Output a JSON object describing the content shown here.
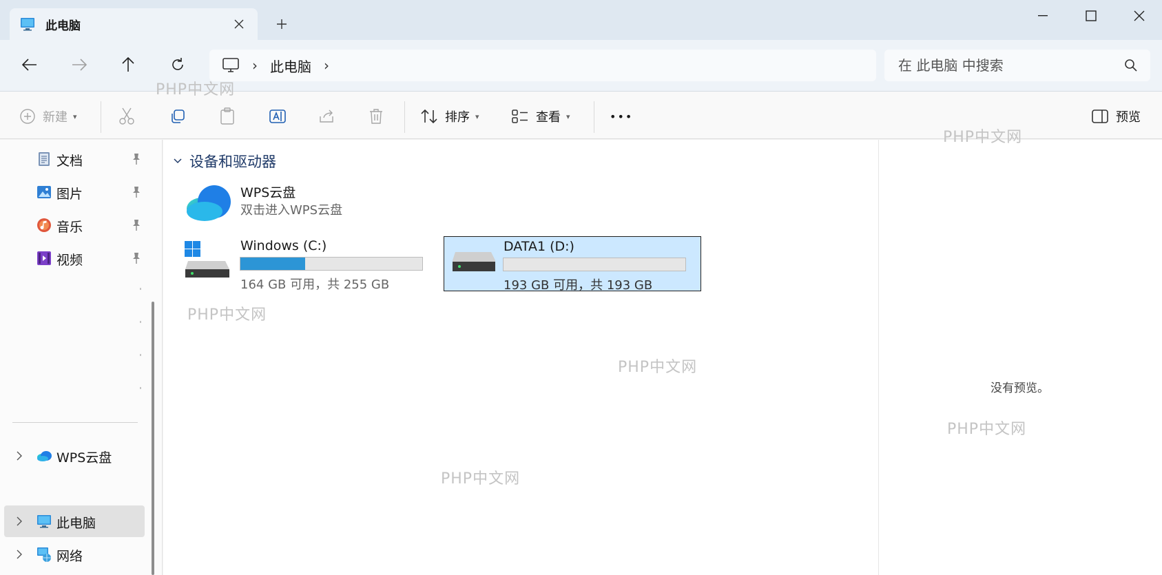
{
  "window": {
    "tab_title": "此电脑",
    "new_tab_symbol": "+"
  },
  "address": {
    "crumb": "此电脑",
    "search_placeholder": "在 此电脑 中搜索"
  },
  "commands": {
    "new_label": "新建",
    "sort_label": "排序",
    "view_label": "查看",
    "more_label": "•••",
    "preview_label": "预览"
  },
  "sidebar": {
    "quick_items": [
      {
        "label": "文档",
        "icon": "document-icon"
      },
      {
        "label": "图片",
        "icon": "pictures-icon"
      },
      {
        "label": "音乐",
        "icon": "music-icon"
      },
      {
        "label": "视频",
        "icon": "video-icon"
      }
    ],
    "wps": "WPS云盘",
    "this_pc": "此电脑",
    "network": "网络"
  },
  "content": {
    "section_title": "设备和驱动器",
    "wps_drive": {
      "name": "WPS云盘",
      "subtitle": "双击进入WPS云盘"
    },
    "drives": [
      {
        "name": "Windows (C:)",
        "info": "164 GB 可用，共 255 GB",
        "used_fraction": 0.357
      },
      {
        "name": "DATA1 (D:)",
        "info": "193 GB 可用，共 193 GB",
        "used_fraction": 0.0
      }
    ]
  },
  "preview": {
    "empty_text": "没有预览。"
  },
  "watermark": "PHP中文网",
  "colors": {
    "accent": "#2c95d6",
    "selected_bg": "#cce8ff"
  }
}
